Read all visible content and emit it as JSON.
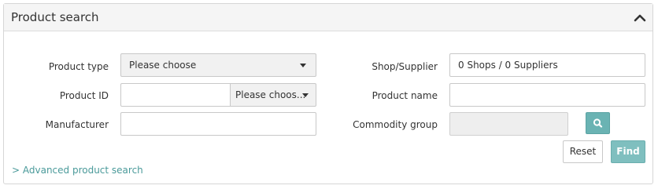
{
  "panel": {
    "title": "Product search",
    "collapse_icon": "chevron-up-icon"
  },
  "form": {
    "product_type": {
      "label": "Product type",
      "value": "Please choose"
    },
    "product_id": {
      "label": "Product ID",
      "value": "",
      "dropdown_value": "Please choos..."
    },
    "manufacturer": {
      "label": "Manufacturer",
      "value": ""
    },
    "shop_supplier": {
      "label": "Shop/Supplier",
      "value": "0 Shops / 0 Suppliers"
    },
    "product_name": {
      "label": "Product name",
      "value": ""
    },
    "commodity_group": {
      "label": "Commodity group",
      "value": "",
      "search_icon": "search-icon"
    }
  },
  "actions": {
    "reset_label": "Reset",
    "find_label": "Find"
  },
  "advanced_link": "> Advanced product search",
  "colors": {
    "accent": "#6ab3b3",
    "link": "#4a9a9a"
  }
}
